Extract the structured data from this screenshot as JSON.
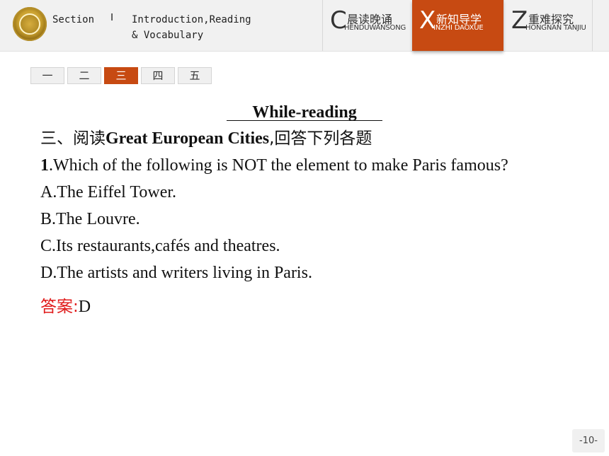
{
  "header": {
    "section_label": "Section",
    "section_number": "Ⅰ",
    "section_title_line1": "Introduction,Reading",
    "section_title_line2": "& Vocabulary",
    "tabs": [
      {
        "letter": "C",
        "label": "晨读晚诵",
        "pinyin": "HENDUWANSONG",
        "active": false
      },
      {
        "letter": "X",
        "label": "新知导学",
        "pinyin": "INZHI DAOXUE",
        "active": true
      },
      {
        "letter": "Z",
        "label": "重难探究",
        "pinyin": "HONGNAN TANJIU",
        "active": false
      }
    ]
  },
  "page_tabs": [
    {
      "label": "一",
      "active": false
    },
    {
      "label": "二",
      "active": false
    },
    {
      "label": "三",
      "active": true
    },
    {
      "label": "四",
      "active": false
    },
    {
      "label": "五",
      "active": false
    }
  ],
  "content": {
    "heading": "While-reading",
    "instruction_prefix": "三、阅读",
    "instruction_title": "Great European Cities",
    "instruction_suffix": ",回答下列各题",
    "question_number": "1",
    "question_text": ".Which of the following is NOT the element to make Paris famous?",
    "options": [
      "A.The Eiffel Tower.",
      "B.The Louvre.",
      "C.Its restaurants,cafés and theatres.",
      "D.The artists and writers living in Paris."
    ],
    "answer_label": "答案:",
    "answer_value": "D"
  },
  "footer": {
    "page_number": "-10-"
  },
  "colors": {
    "accent": "#c74a12",
    "answer_label": "#e01a1a"
  }
}
